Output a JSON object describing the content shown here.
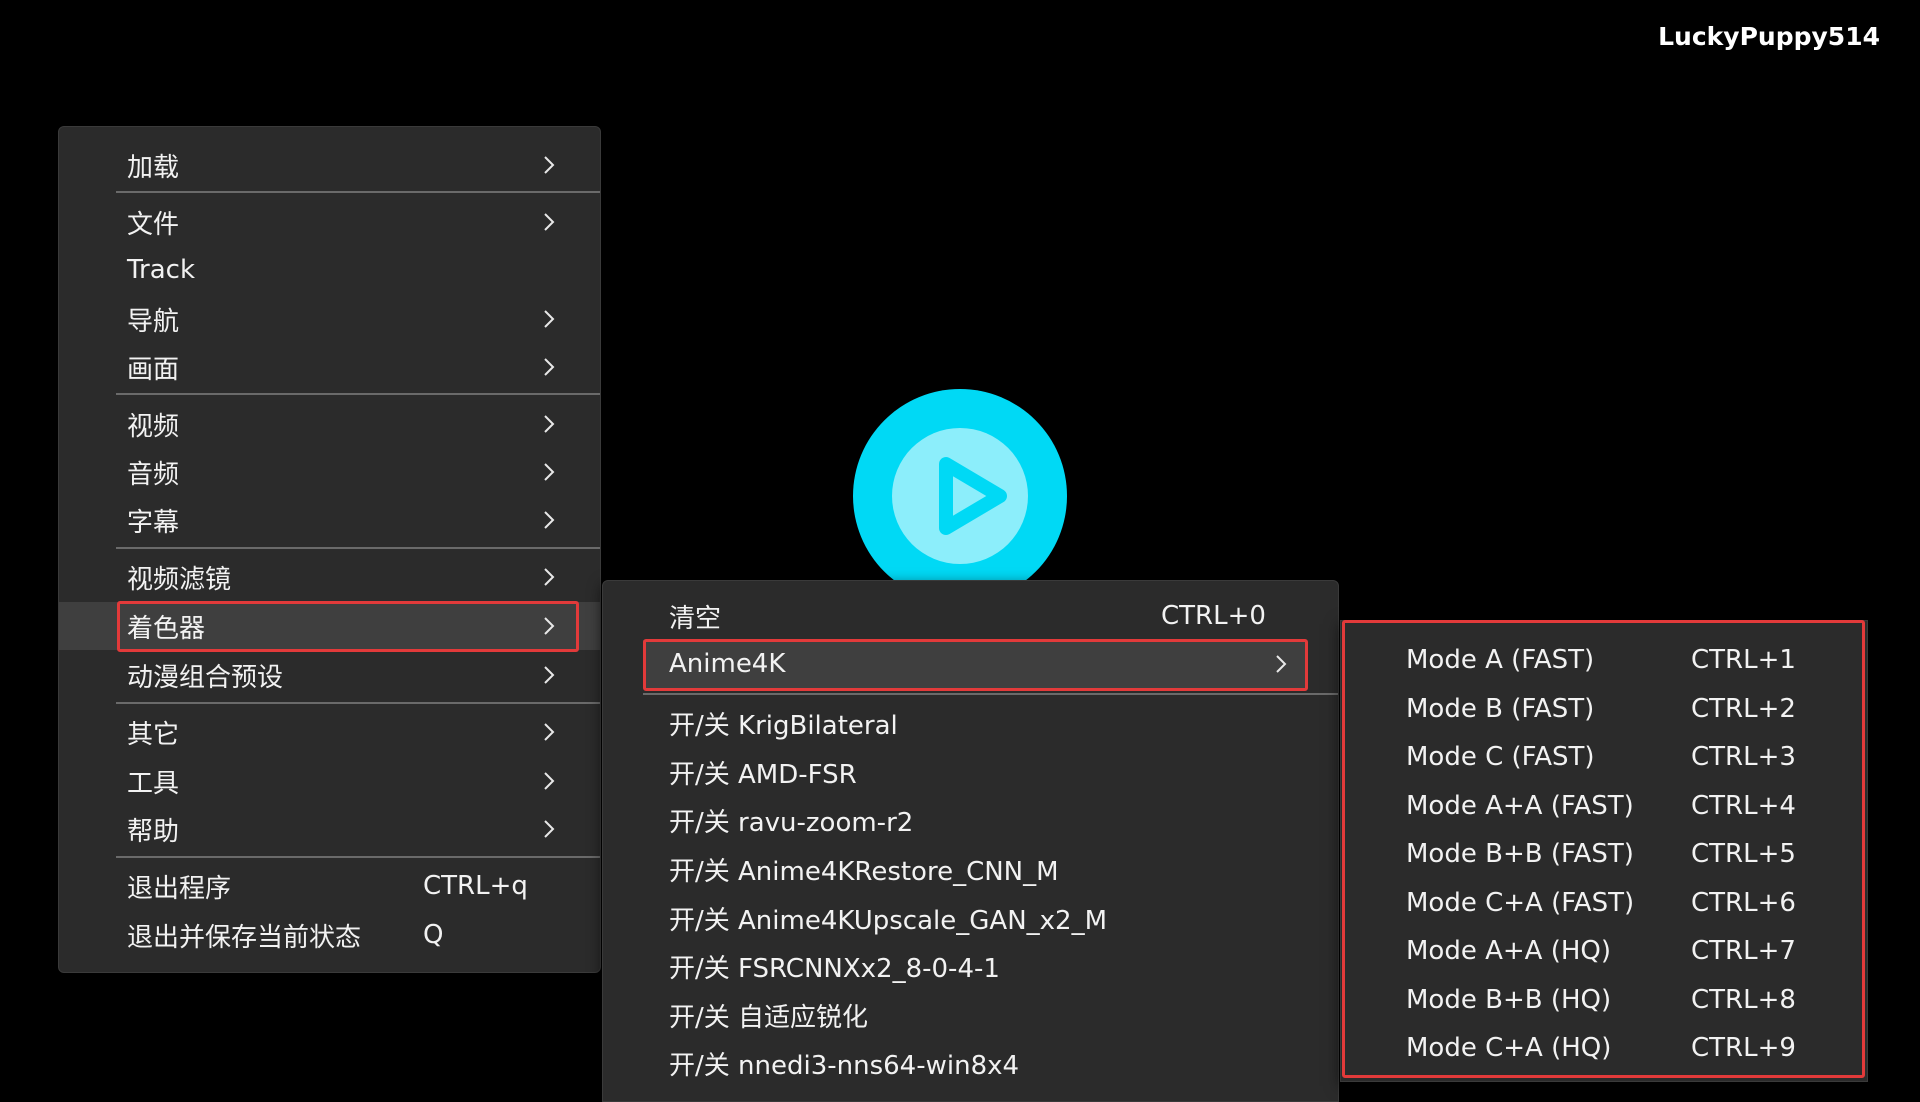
{
  "watermark": "LuckyPuppy514",
  "main_menu": {
    "items": [
      {
        "label": "加载",
        "submenu": true
      },
      {
        "label": "文件",
        "submenu": true
      },
      {
        "label": "Track",
        "submenu": false
      },
      {
        "label": "导航",
        "submenu": true
      },
      {
        "label": "画面",
        "submenu": true
      },
      {
        "label": "视频",
        "submenu": true
      },
      {
        "label": "音频",
        "submenu": true
      },
      {
        "label": "字幕",
        "submenu": true
      },
      {
        "label": "视频滤镜",
        "submenu": true
      },
      {
        "label": "着色器",
        "submenu": true,
        "highlighted": true
      },
      {
        "label": "动漫组合预设",
        "submenu": true
      },
      {
        "label": "其它",
        "submenu": true
      },
      {
        "label": "工具",
        "submenu": true
      },
      {
        "label": "帮助",
        "submenu": true
      },
      {
        "label": "退出程序",
        "shortcut": "CTRL+q"
      },
      {
        "label": "退出并保存当前状态",
        "shortcut": "Q"
      }
    ]
  },
  "shader_menu": {
    "items": [
      {
        "label": "清空",
        "shortcut": "CTRL+0"
      },
      {
        "label": "Anime4K",
        "submenu": true,
        "highlighted": true
      },
      {
        "label": "开/关 KrigBilateral"
      },
      {
        "label": "开/关 AMD-FSR"
      },
      {
        "label": "开/关 ravu-zoom-r2"
      },
      {
        "label": "开/关 Anime4KRestore_CNN_M"
      },
      {
        "label": "开/关 Anime4KUpscale_GAN_x2_M"
      },
      {
        "label": "开/关 FSRCNNXx2_8-0-4-1"
      },
      {
        "label": "开/关 自适应锐化"
      },
      {
        "label": "开/关 nnedi3-nns64-win8x4"
      }
    ]
  },
  "anime4k_menu": {
    "items": [
      {
        "label": "Mode A (FAST)",
        "shortcut": "CTRL+1"
      },
      {
        "label": "Mode B (FAST)",
        "shortcut": "CTRL+2"
      },
      {
        "label": "Mode C (FAST)",
        "shortcut": "CTRL+3"
      },
      {
        "label": "Mode A+A (FAST)",
        "shortcut": "CTRL+4"
      },
      {
        "label": "Mode B+B (FAST)",
        "shortcut": "CTRL+5"
      },
      {
        "label": "Mode C+A (FAST)",
        "shortcut": "CTRL+6"
      },
      {
        "label": "Mode A+A (HQ)",
        "shortcut": "CTRL+7"
      },
      {
        "label": "Mode B+B (HQ)",
        "shortcut": "CTRL+8"
      },
      {
        "label": "Mode C+A (HQ)",
        "shortcut": "CTRL+9"
      }
    ]
  },
  "colors": {
    "menu_bg": "#2b2b2b",
    "highlight_bg": "#3f3f3f",
    "annotation_red": "#e23a3a",
    "play_button": "#00d9f5"
  },
  "icons": {
    "play": "play-icon",
    "chevron": "chevron-right-icon"
  }
}
